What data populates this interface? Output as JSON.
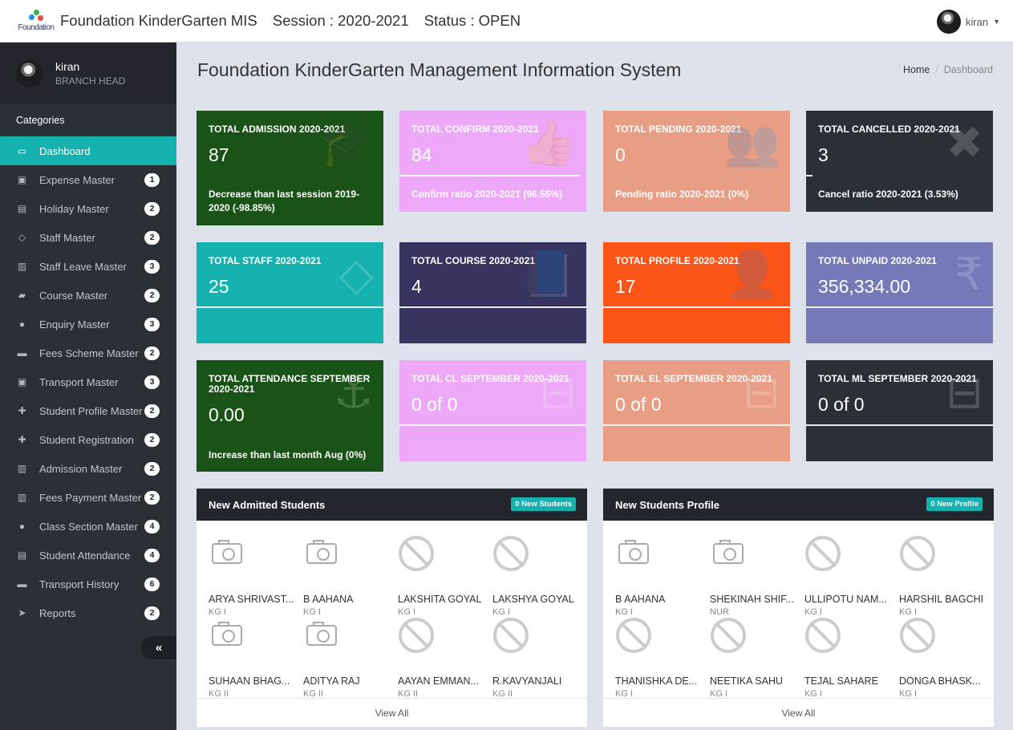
{
  "header": {
    "logo_text": "Foundation",
    "app_name": "Foundation KinderGarten MIS",
    "session": "Session : 2020-2021",
    "status": "Status : OPEN",
    "user": "kiran"
  },
  "sidebar": {
    "user_name": "kiran",
    "user_role": "BRANCH HEAD",
    "categories_label": "Categories",
    "items": [
      {
        "label": "Dashboard",
        "icon": "laptop-icon",
        "glyph": "▭",
        "badge": ""
      },
      {
        "label": "Expense Master",
        "icon": "money-icon",
        "glyph": "▣",
        "badge": "1"
      },
      {
        "label": "Holiday Master",
        "icon": "calendar-icon",
        "glyph": "▤",
        "badge": "2"
      },
      {
        "label": "Staff Master",
        "icon": "diamond-icon",
        "glyph": "◇",
        "badge": "2"
      },
      {
        "label": "Staff Leave Master",
        "icon": "save-icon",
        "glyph": "▥",
        "badge": "3"
      },
      {
        "label": "Course Master",
        "icon": "book-icon",
        "glyph": "▰",
        "badge": "2"
      },
      {
        "label": "Enquiry Master",
        "icon": "users-icon",
        "glyph": "●",
        "badge": "3"
      },
      {
        "label": "Fees Scheme Master",
        "icon": "credit-card-icon",
        "glyph": "▬",
        "badge": "2"
      },
      {
        "label": "Transport Master",
        "icon": "bus-icon",
        "glyph": "▣",
        "badge": "3"
      },
      {
        "label": "Student Profile Master",
        "icon": "user-plus-icon",
        "glyph": "✚",
        "badge": "2"
      },
      {
        "label": "Student Registration",
        "icon": "user-plus-icon",
        "glyph": "✚",
        "badge": "2"
      },
      {
        "label": "Admission Master",
        "icon": "save-icon",
        "glyph": "▥",
        "badge": "2"
      },
      {
        "label": "Fees Payment Master",
        "icon": "save-icon",
        "glyph": "▥",
        "badge": "2"
      },
      {
        "label": "Class Section Master",
        "icon": "users-icon",
        "glyph": "●",
        "badge": "4"
      },
      {
        "label": "Student Attendance",
        "icon": "contact-book-icon",
        "glyph": "▤",
        "badge": "4"
      },
      {
        "label": "Transport History",
        "icon": "car-icon",
        "glyph": "▬",
        "badge": "6"
      },
      {
        "label": "Reports",
        "icon": "paper-plane-icon",
        "glyph": "➤",
        "badge": "2"
      }
    ],
    "collapse_glyph": "«"
  },
  "main": {
    "title": "Foundation KinderGarten Management Information System",
    "breadcrumb_home": "Home",
    "breadcrumb_current": "Dashboard"
  },
  "cards": [
    {
      "title": "TOTAL ADMISSION 2020-2021",
      "value": "87",
      "footer": "Decrease than last session 2019-2020 (-98.85%)",
      "icon": "graduation-cap-icon",
      "glyph": "🎓",
      "color": "#1a5317",
      "progress": 0.0
    },
    {
      "title": "TOTAL CONFIRM 2020-2021",
      "value": "84",
      "footer": "Confirm ratio 2020-2021 (96.55%)",
      "icon": "thumbs-up-icon",
      "glyph": "👍",
      "color": "#eda8f8",
      "progress": 96.55
    },
    {
      "title": "TOTAL PENDING 2020-2021",
      "value": "0",
      "footer": "Pending ratio 2020-2021 (0%)",
      "icon": "group-icon",
      "glyph": "👥",
      "color": "#e89e84",
      "progress": 0
    },
    {
      "title": "TOTAL CANCELLED 2020-2021",
      "value": "3",
      "footer": "Cancel ratio 2020-2021 (3.53%)",
      "icon": "times-icon",
      "glyph": "✖",
      "color": "#2b3037",
      "progress": 3.53
    },
    {
      "title": "TOTAL STAFF 2020-2021",
      "value": "25",
      "footer": "",
      "icon": "diamond-icon",
      "glyph": "◇",
      "color": "#15b1ae",
      "progress": 100
    },
    {
      "title": "TOTAL COURSE 2020-2021",
      "value": "4",
      "footer": "",
      "icon": "book-icon",
      "glyph": "📘",
      "color": "#37345f",
      "progress": 100
    },
    {
      "title": "TOTAL PROFILE 2020-2021",
      "value": "17",
      "footer": "",
      "icon": "user-plus-icon",
      "glyph": "👤",
      "color": "#fb5518",
      "progress": 100
    },
    {
      "title": "TOTAL UNPAID 2020-2021",
      "value": "356,334.00",
      "footer": "",
      "icon": "rupee-icon",
      "glyph": "₹",
      "color": "#7579b8",
      "progress": 100
    },
    {
      "title": "TOTAL ATTENDANCE SEPTEMBER 2020-2021",
      "value": "0.00",
      "footer": "Increase than last month Aug (0%)",
      "icon": "anchor-icon",
      "glyph": "⚓",
      "color": "#1a5317",
      "progress": 0
    },
    {
      "title": "TOTAL CL SEPTEMBER 2020-2021",
      "value": "0 of 0",
      "footer": "",
      "icon": "minus-square-icon",
      "glyph": "⊟",
      "color": "#eda8f8",
      "progress": 100
    },
    {
      "title": "TOTAL EL SEPTEMBER 2020-2021",
      "value": "0 of 0",
      "footer": "",
      "icon": "minus-square-icon",
      "glyph": "⊟",
      "color": "#e89e84",
      "progress": 100
    },
    {
      "title": "TOTAL ML SEPTEMBER 2020-2021",
      "value": "0 of 0",
      "footer": "",
      "icon": "minus-square-icon",
      "glyph": "⊟",
      "color": "#2b3037",
      "progress": 100
    }
  ],
  "panels": [
    {
      "title": "New Admitted Students",
      "tag": "0 New Students",
      "view_all": "View All",
      "students": [
        {
          "name": "ARYA SHRIVAST...",
          "class": "KG I",
          "img": "camera"
        },
        {
          "name": "B AAHANA",
          "class": "KG I",
          "img": "camera"
        },
        {
          "name": "LAKSHITA GOYAL",
          "class": "KG I",
          "img": "noimg"
        },
        {
          "name": "LAKSHYA GOYAL",
          "class": "KG I",
          "img": "noimg"
        },
        {
          "name": "SUHAAN BHAG...",
          "class": "KG II",
          "img": "camera"
        },
        {
          "name": "ADITYA RAJ",
          "class": "KG II",
          "img": "camera"
        },
        {
          "name": "AAYAN EMMAN...",
          "class": "KG II",
          "img": "noimg"
        },
        {
          "name": "R.KAVYANJALI",
          "class": "KG II",
          "img": "noimg"
        }
      ]
    },
    {
      "title": "New Students Profile",
      "tag": "0 New Profile",
      "view_all": "View All",
      "students": [
        {
          "name": "B AAHANA",
          "class": "KG I",
          "img": "camera"
        },
        {
          "name": "SHEKINAH SHIF...",
          "class": "NUR",
          "img": "camera"
        },
        {
          "name": "ULLIPOTU NAM...",
          "class": "KG I",
          "img": "noimg"
        },
        {
          "name": "HARSHIL BAGCHI",
          "class": "KG I",
          "img": "noimg"
        },
        {
          "name": "THANISHKA DE...",
          "class": "KG I",
          "img": "noimg"
        },
        {
          "name": "NEETIKA SAHU",
          "class": "KG I",
          "img": "noimg"
        },
        {
          "name": "TEJAL SAHARE",
          "class": "KG I",
          "img": "noimg"
        },
        {
          "name": "DONGA BHASK...",
          "class": "KG I",
          "img": "noimg"
        }
      ]
    }
  ]
}
